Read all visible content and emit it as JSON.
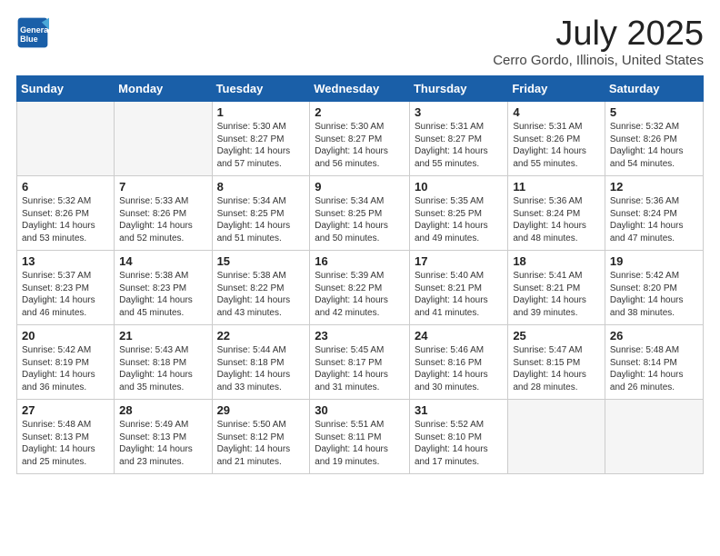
{
  "header": {
    "logo_line1": "General",
    "logo_line2": "Blue",
    "month": "July 2025",
    "location": "Cerro Gordo, Illinois, United States"
  },
  "weekdays": [
    "Sunday",
    "Monday",
    "Tuesday",
    "Wednesday",
    "Thursday",
    "Friday",
    "Saturday"
  ],
  "weeks": [
    [
      {
        "day": "",
        "info": ""
      },
      {
        "day": "",
        "info": ""
      },
      {
        "day": "1",
        "info": "Sunrise: 5:30 AM\nSunset: 8:27 PM\nDaylight: 14 hours and 57 minutes."
      },
      {
        "day": "2",
        "info": "Sunrise: 5:30 AM\nSunset: 8:27 PM\nDaylight: 14 hours and 56 minutes."
      },
      {
        "day": "3",
        "info": "Sunrise: 5:31 AM\nSunset: 8:27 PM\nDaylight: 14 hours and 55 minutes."
      },
      {
        "day": "4",
        "info": "Sunrise: 5:31 AM\nSunset: 8:26 PM\nDaylight: 14 hours and 55 minutes."
      },
      {
        "day": "5",
        "info": "Sunrise: 5:32 AM\nSunset: 8:26 PM\nDaylight: 14 hours and 54 minutes."
      }
    ],
    [
      {
        "day": "6",
        "info": "Sunrise: 5:32 AM\nSunset: 8:26 PM\nDaylight: 14 hours and 53 minutes."
      },
      {
        "day": "7",
        "info": "Sunrise: 5:33 AM\nSunset: 8:26 PM\nDaylight: 14 hours and 52 minutes."
      },
      {
        "day": "8",
        "info": "Sunrise: 5:34 AM\nSunset: 8:25 PM\nDaylight: 14 hours and 51 minutes."
      },
      {
        "day": "9",
        "info": "Sunrise: 5:34 AM\nSunset: 8:25 PM\nDaylight: 14 hours and 50 minutes."
      },
      {
        "day": "10",
        "info": "Sunrise: 5:35 AM\nSunset: 8:25 PM\nDaylight: 14 hours and 49 minutes."
      },
      {
        "day": "11",
        "info": "Sunrise: 5:36 AM\nSunset: 8:24 PM\nDaylight: 14 hours and 48 minutes."
      },
      {
        "day": "12",
        "info": "Sunrise: 5:36 AM\nSunset: 8:24 PM\nDaylight: 14 hours and 47 minutes."
      }
    ],
    [
      {
        "day": "13",
        "info": "Sunrise: 5:37 AM\nSunset: 8:23 PM\nDaylight: 14 hours and 46 minutes."
      },
      {
        "day": "14",
        "info": "Sunrise: 5:38 AM\nSunset: 8:23 PM\nDaylight: 14 hours and 45 minutes."
      },
      {
        "day": "15",
        "info": "Sunrise: 5:38 AM\nSunset: 8:22 PM\nDaylight: 14 hours and 43 minutes."
      },
      {
        "day": "16",
        "info": "Sunrise: 5:39 AM\nSunset: 8:22 PM\nDaylight: 14 hours and 42 minutes."
      },
      {
        "day": "17",
        "info": "Sunrise: 5:40 AM\nSunset: 8:21 PM\nDaylight: 14 hours and 41 minutes."
      },
      {
        "day": "18",
        "info": "Sunrise: 5:41 AM\nSunset: 8:21 PM\nDaylight: 14 hours and 39 minutes."
      },
      {
        "day": "19",
        "info": "Sunrise: 5:42 AM\nSunset: 8:20 PM\nDaylight: 14 hours and 38 minutes."
      }
    ],
    [
      {
        "day": "20",
        "info": "Sunrise: 5:42 AM\nSunset: 8:19 PM\nDaylight: 14 hours and 36 minutes."
      },
      {
        "day": "21",
        "info": "Sunrise: 5:43 AM\nSunset: 8:18 PM\nDaylight: 14 hours and 35 minutes."
      },
      {
        "day": "22",
        "info": "Sunrise: 5:44 AM\nSunset: 8:18 PM\nDaylight: 14 hours and 33 minutes."
      },
      {
        "day": "23",
        "info": "Sunrise: 5:45 AM\nSunset: 8:17 PM\nDaylight: 14 hours and 31 minutes."
      },
      {
        "day": "24",
        "info": "Sunrise: 5:46 AM\nSunset: 8:16 PM\nDaylight: 14 hours and 30 minutes."
      },
      {
        "day": "25",
        "info": "Sunrise: 5:47 AM\nSunset: 8:15 PM\nDaylight: 14 hours and 28 minutes."
      },
      {
        "day": "26",
        "info": "Sunrise: 5:48 AM\nSunset: 8:14 PM\nDaylight: 14 hours and 26 minutes."
      }
    ],
    [
      {
        "day": "27",
        "info": "Sunrise: 5:48 AM\nSunset: 8:13 PM\nDaylight: 14 hours and 25 minutes."
      },
      {
        "day": "28",
        "info": "Sunrise: 5:49 AM\nSunset: 8:13 PM\nDaylight: 14 hours and 23 minutes."
      },
      {
        "day": "29",
        "info": "Sunrise: 5:50 AM\nSunset: 8:12 PM\nDaylight: 14 hours and 21 minutes."
      },
      {
        "day": "30",
        "info": "Sunrise: 5:51 AM\nSunset: 8:11 PM\nDaylight: 14 hours and 19 minutes."
      },
      {
        "day": "31",
        "info": "Sunrise: 5:52 AM\nSunset: 8:10 PM\nDaylight: 14 hours and 17 minutes."
      },
      {
        "day": "",
        "info": ""
      },
      {
        "day": "",
        "info": ""
      }
    ]
  ]
}
